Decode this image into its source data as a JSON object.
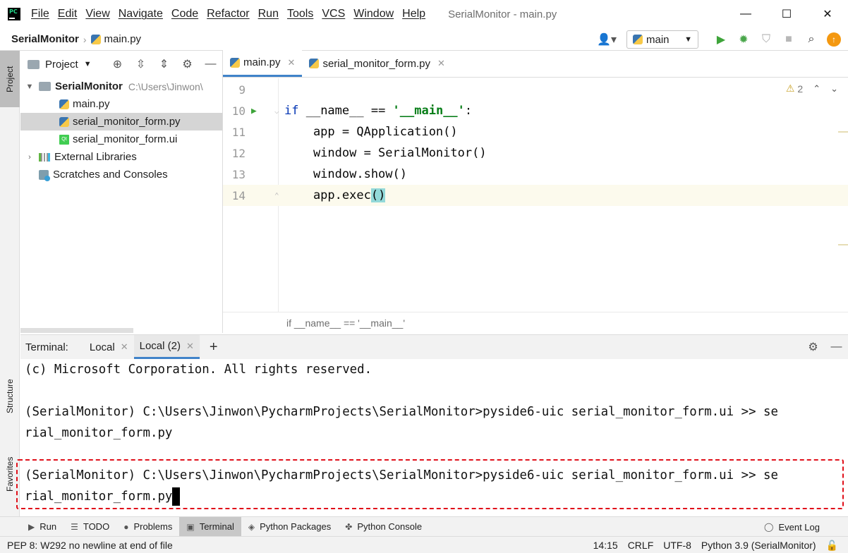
{
  "titlebar": {
    "app_icon_text": "PC",
    "menu": [
      "File",
      "Edit",
      "View",
      "Navigate",
      "Code",
      "Refactor",
      "Run",
      "Tools",
      "VCS",
      "Window",
      "Help"
    ],
    "window_title": "SerialMonitor - main.py",
    "controls": {
      "minimize": "—",
      "maximize": "☐",
      "close": "✕"
    }
  },
  "navbar": {
    "project": "SerialMonitor",
    "separator": "›",
    "file": "main.py",
    "run_config": "main"
  },
  "stripe": {
    "project": "Project",
    "structure": "Structure",
    "favorites": "Favorites"
  },
  "project_panel": {
    "title": "Project",
    "tree": {
      "root_name": "SerialMonitor",
      "root_path": "C:\\Users\\Jinwon\\",
      "files": [
        "main.py",
        "serial_monitor_form.py",
        "serial_monitor_form.ui"
      ],
      "external": "External Libraries",
      "scratches": "Scratches and Consoles"
    },
    "qt_badge": "Qt"
  },
  "editor": {
    "tabs": [
      "main.py",
      "serial_monitor_form.py"
    ],
    "inspection_count": "2",
    "lines": [
      {
        "no": "9",
        "text": ""
      },
      {
        "no": "10",
        "kw": "if",
        "mid": " __name__ == ",
        "str": "'__main__'",
        "end": ":"
      },
      {
        "no": "11",
        "text": "    app = QApplication()"
      },
      {
        "no": "12",
        "text": "    window = SerialMonitor()"
      },
      {
        "no": "13",
        "text": "    window.show()"
      },
      {
        "no": "14",
        "pre": "    app.exec",
        "paren": "()"
      }
    ],
    "breadcrumb": "if __name__ == '__main__'"
  },
  "terminal": {
    "label": "Terminal:",
    "tabs": [
      "Local",
      "Local (2)"
    ],
    "lines": [
      "(c) Microsoft Corporation. All rights reserved.",
      "",
      "(SerialMonitor) C:\\Users\\Jinwon\\PycharmProjects\\SerialMonitor>pyside6-uic serial_monitor_form.ui >> se",
      "rial_monitor_form.py",
      "",
      "(SerialMonitor) C:\\Users\\Jinwon\\PycharmProjects\\SerialMonitor>pyside6-uic serial_monitor_form.ui >> se",
      "rial_monitor_form.py"
    ]
  },
  "bottom_tools": {
    "items": [
      "Run",
      "TODO",
      "Problems",
      "Terminal",
      "Python Packages",
      "Python Console"
    ],
    "event_log": "Event Log"
  },
  "statusbar": {
    "message": "PEP 8: W292 no newline at end of file",
    "position": "14:15",
    "line_sep": "CRLF",
    "encoding": "UTF-8",
    "interpreter": "Python 3.9 (SerialMonitor)"
  },
  "colors": {
    "accent": "#4083c9",
    "run_green": "#3ea43a",
    "highlight_red": "#e0101a",
    "keyword": "#0033b3",
    "string": "#067d17"
  }
}
